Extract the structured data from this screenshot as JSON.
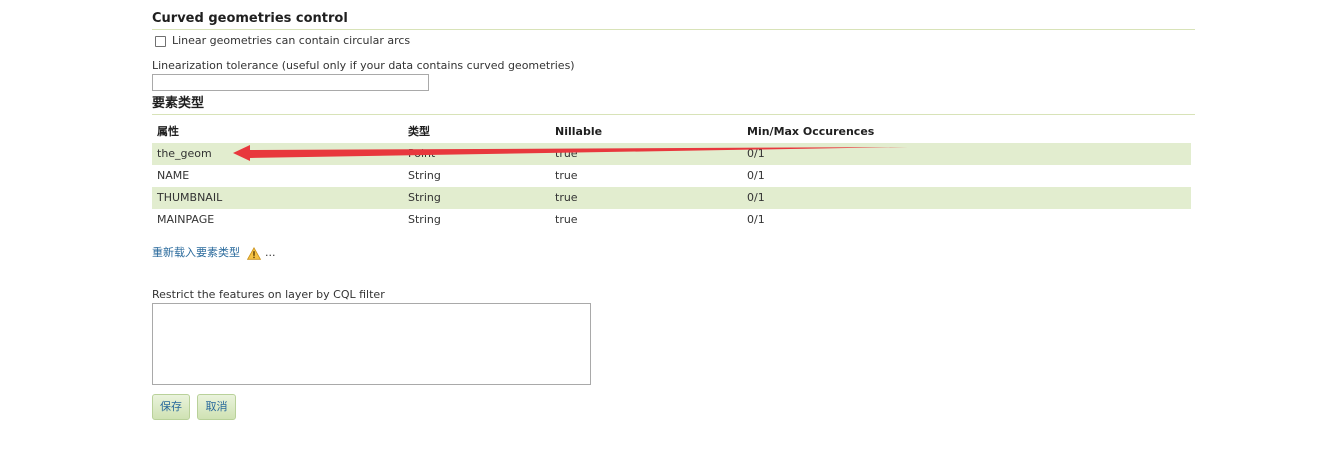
{
  "curved": {
    "title": "Curved geometries control",
    "checkbox_label": "Linear geometries can contain circular arcs",
    "tolerance_label": "Linearization tolerance (useful only if your data contains curved geometries)",
    "tolerance_value": ""
  },
  "feature_type": {
    "title": "要素类型",
    "headers": [
      "属性",
      "类型",
      "Nillable",
      "Min/Max Occurences"
    ],
    "rows": [
      [
        "the_geom",
        "Point",
        "true",
        "0/1"
      ],
      [
        "NAME",
        "String",
        "true",
        "0/1"
      ],
      [
        "THUMBNAIL",
        "String",
        "true",
        "0/1"
      ],
      [
        "MAINPAGE",
        "String",
        "true",
        "0/1"
      ]
    ],
    "reload_link": "重新载入要素类型",
    "reload_ellipsis": "..."
  },
  "cql": {
    "label": "Restrict the features on layer by CQL filter",
    "value": ""
  },
  "buttons": {
    "save": "保存",
    "cancel": "取消"
  },
  "colors": {
    "row_highlight": "#e2edcf",
    "link": "#2a6a9c",
    "annotation_arrow": "#e8383d",
    "warning": "#f0b429"
  }
}
